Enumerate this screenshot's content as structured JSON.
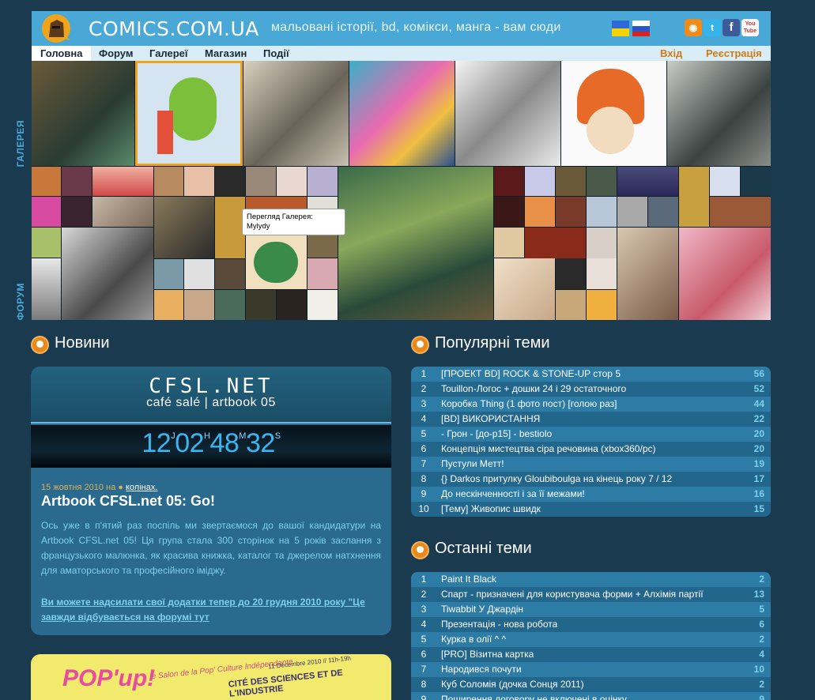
{
  "header": {
    "site_title": "COMICS.COM.UA",
    "tagline": "мальовані історії, bd, комікси, манга - вам сюди",
    "flags": [
      "ua-flag",
      "ru-flag"
    ],
    "social": [
      "rss-icon",
      "twitter-icon",
      "facebook-icon",
      "youtube-icon"
    ],
    "youtube_label": "You Tube"
  },
  "nav": {
    "items": [
      "Головна",
      "Форум",
      "Галереї",
      "Магазин",
      "Події"
    ],
    "login": "Вхід",
    "register": "Реєстрація"
  },
  "mosaic": {
    "gallery_label": "ГАЛЕРЕЯ",
    "forum_label": "ФОРУМ",
    "tooltip_line1": "Перегляд Галерея:",
    "tooltip_line2": "Mylydy"
  },
  "news": {
    "heading": "Новини",
    "banner_title": "CFSL.NET",
    "banner_sub": "café salé | artbook 05",
    "timer": {
      "d": "12",
      "h": "02",
      "m": "48",
      "s": "32",
      "h_unit": "J",
      "hh_unit": "H",
      "m_unit": "M",
      "s_unit": "S"
    },
    "date": "15 жовтня 2010 на",
    "author": "колінах.",
    "title": "Artbook CFSL.net 05: Go!",
    "body": "Ось уже в п'ятий раз поспіль ми звертаємося до вашої кандидатури на Artbook CFSL.net 05! Ця група стала 300 сторінок на 5 років заслання з французького малюнка, як красива книжка, каталог та джерелом натхнення для аматорського та професійного іміджу.",
    "link": "Ви можете надсилати свої додатки тепер до 20 грудня 2010 року \"Це завжди відбувається на форумі тут"
  },
  "popup_banner": {
    "logo": "POP'up!",
    "sub": "le Salon de la Pop' Culture Indépendante",
    "date": "11 Décembre 2010 // 11h-19h",
    "cite": "CITÉ DES SCIENCES ET DE L'INDUSTRIE"
  },
  "popular": {
    "heading": "Популярні теми",
    "rows": [
      {
        "n": "1",
        "title": "[ПРОЕКТ BD] ROCK & STONE-UP стор 5",
        "count": "56"
      },
      {
        "n": "2",
        "title": "Touillon-Логос + дошки 24 і 29 остаточного",
        "count": "52"
      },
      {
        "n": "3",
        "title": "Коробка Thing (1 фото пост) [голою раз]",
        "count": "44"
      },
      {
        "n": "4",
        "title": "[BD] ВИКОРИСТАННЯ",
        "count": "22"
      },
      {
        "n": "5",
        "title": "- Грон - [до-p15] - bestiolo",
        "count": "20"
      },
      {
        "n": "6",
        "title": "Концепція мистецтва сіра речовина (xbox360/pc)",
        "count": "20"
      },
      {
        "n": "7",
        "title": "Пустули Метт!",
        "count": "19"
      },
      {
        "n": "8",
        "title": "{} Darkos притулку Gloubiboulga на кінець року 7 / 12",
        "count": "17"
      },
      {
        "n": "9",
        "title": "До нескінченності і за її межами!",
        "count": "16"
      },
      {
        "n": "10",
        "title": "[Тему] Живопис швидк",
        "count": "15"
      }
    ]
  },
  "latest": {
    "heading": "Останні теми",
    "rows": [
      {
        "n": "1",
        "title": "Paint It Black",
        "count": "2"
      },
      {
        "n": "2",
        "title": "Спарт - призначені для користувача форми + Алхімія партії",
        "count": "13"
      },
      {
        "n": "3",
        "title": "Tiwabbit У Джардін",
        "count": "5"
      },
      {
        "n": "4",
        "title": "Презентація - нова робота",
        "count": "6"
      },
      {
        "n": "5",
        "title": "Курка в олії ^ ^",
        "count": "2"
      },
      {
        "n": "6",
        "title": "[PRO] Візитна картка",
        "count": "4"
      },
      {
        "n": "7",
        "title": "Народився почути",
        "count": "10"
      },
      {
        "n": "8",
        "title": "Куб Соломія (дочка Сонця 2011)",
        "count": "2"
      },
      {
        "n": "9",
        "title": "Поширення договору не включені в оцінку",
        "count": "9"
      }
    ]
  },
  "colors": {
    "bg": "#1a3a50",
    "header": "#4aa8d6",
    "accent": "#e8891c",
    "link": "#7dd0ee"
  }
}
